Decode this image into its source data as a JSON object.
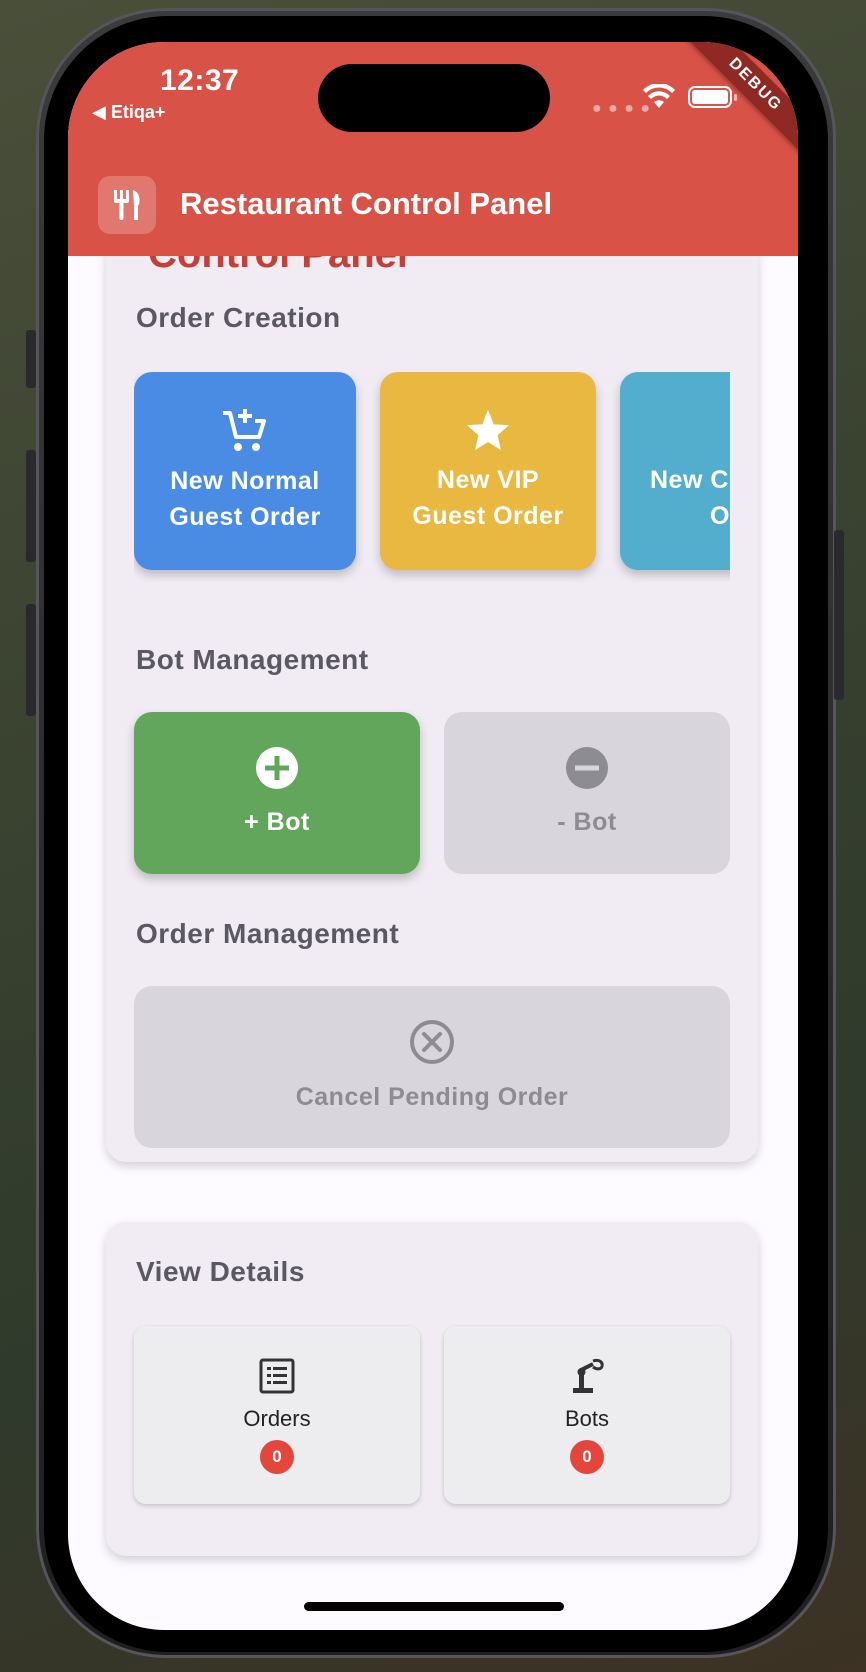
{
  "status_bar": {
    "time": "12:37",
    "carrier": "◀ Etiqa+",
    "debug_label": "DEBUG"
  },
  "app_bar": {
    "title": "Restaurant Control Panel",
    "icon": "restaurant-utensils-icon",
    "color": "#d95247"
  },
  "control_card": {
    "cut_heading": "Control Panel",
    "order_creation": {
      "title": "Order Creation",
      "buttons": [
        {
          "label_line1": "New Normal",
          "label_line2": "Guest Order",
          "icon": "add-cart-icon",
          "color": "#4a8be4"
        },
        {
          "label_line1": "New VIP",
          "label_line2": "Guest Order",
          "icon": "star-icon",
          "color": "#e9b841"
        },
        {
          "label_line1": "New C",
          "label_line2": "O",
          "icon": "partial-icon",
          "color": "#52aecc"
        }
      ]
    },
    "bot_management": {
      "title": "Bot Management",
      "add_label": "+ Bot",
      "remove_label": "- Bot",
      "add_color": "#61a65b",
      "disabled_color": "#d8d5dc"
    },
    "order_management": {
      "title": "Order Management",
      "cancel_label": "Cancel Pending Order"
    }
  },
  "details_card": {
    "title": "View Details",
    "orders": {
      "label": "Orders",
      "count": "0",
      "icon": "list-icon"
    },
    "bots": {
      "label": "Bots",
      "count": "0",
      "icon": "robot-arm-icon"
    }
  }
}
